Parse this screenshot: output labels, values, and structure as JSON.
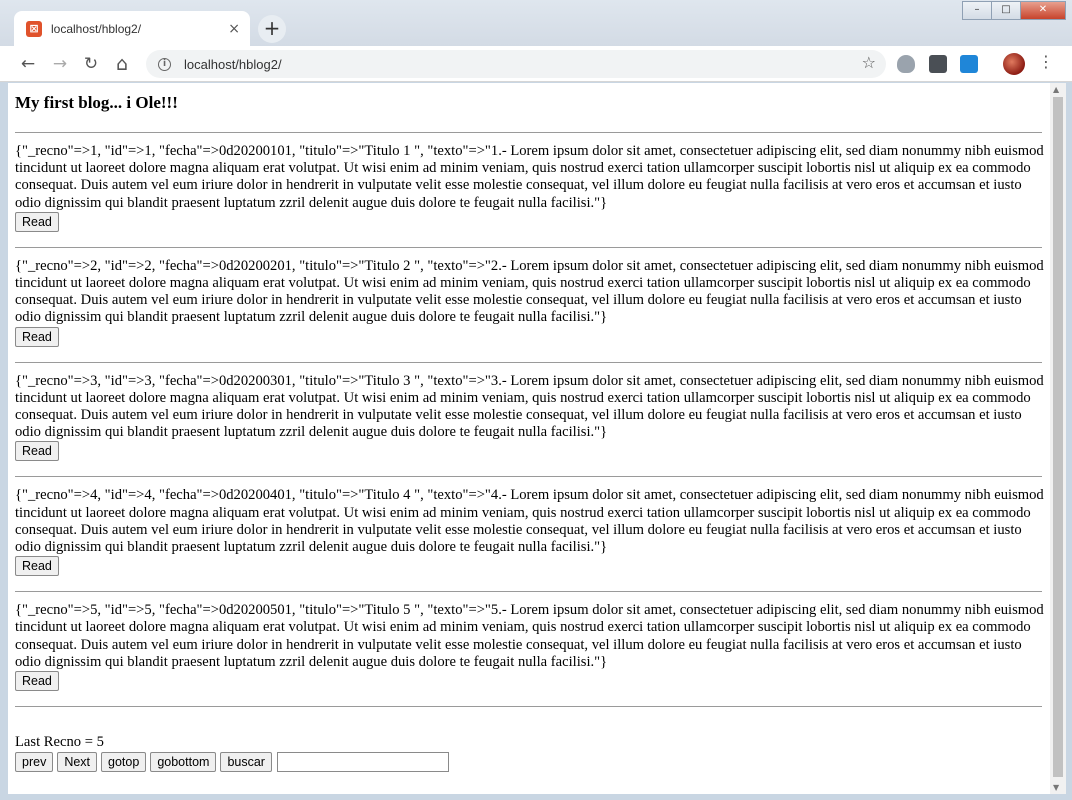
{
  "browser": {
    "tab_title": "localhost/hblog2/",
    "tab_close": "×",
    "new_tab": "+",
    "url": "localhost/hblog2/",
    "window_buttons": {
      "minimize": "–",
      "maximize": "□",
      "close": "✕"
    },
    "icons": {
      "back": "←",
      "forward": "→",
      "reload": "↻",
      "home": "⌂",
      "star": "☆",
      "menu": "⋮",
      "info": "i"
    }
  },
  "page": {
    "title": "My first blog... i Ole!!!",
    "posts": [
      {
        "text": "{\"_recno\"=>1, \"id\"=>1, \"fecha\"=>0d20200101, \"titulo\"=>\"Titulo 1 \", \"texto\"=>\"1.- Lorem ipsum dolor sit amet, consectetuer adipiscing elit, sed diam nonummy nibh euismod tincidunt ut laoreet dolore magna aliquam erat volutpat. Ut wisi enim ad minim veniam, quis nostrud exerci tation ullamcorper suscipit lobortis nisl ut aliquip ex ea commodo consequat. Duis autem vel eum iriure dolor in hendrerit in vulputate velit esse molestie consequat, vel illum dolore eu feugiat nulla facilisis at vero eros et accumsan et iusto odio dignissim qui blandit praesent luptatum zzril delenit augue duis dolore te feugait nulla facilisi.\"}",
        "button": "Read"
      },
      {
        "text": "{\"_recno\"=>2, \"id\"=>2, \"fecha\"=>0d20200201, \"titulo\"=>\"Titulo 2 \", \"texto\"=>\"2.- Lorem ipsum dolor sit amet, consectetuer adipiscing elit, sed diam nonummy nibh euismod tincidunt ut laoreet dolore magna aliquam erat volutpat. Ut wisi enim ad minim veniam, quis nostrud exerci tation ullamcorper suscipit lobortis nisl ut aliquip ex ea commodo consequat. Duis autem vel eum iriure dolor in hendrerit in vulputate velit esse molestie consequat, vel illum dolore eu feugiat nulla facilisis at vero eros et accumsan et iusto odio dignissim qui blandit praesent luptatum zzril delenit augue duis dolore te feugait nulla facilisi.\"}",
        "button": "Read"
      },
      {
        "text": "{\"_recno\"=>3, \"id\"=>3, \"fecha\"=>0d20200301, \"titulo\"=>\"Titulo 3 \", \"texto\"=>\"3.- Lorem ipsum dolor sit amet, consectetuer adipiscing elit, sed diam nonummy nibh euismod tincidunt ut laoreet dolore magna aliquam erat volutpat. Ut wisi enim ad minim veniam, quis nostrud exerci tation ullamcorper suscipit lobortis nisl ut aliquip ex ea commodo consequat. Duis autem vel eum iriure dolor in hendrerit in vulputate velit esse molestie consequat, vel illum dolore eu feugiat nulla facilisis at vero eros et accumsan et iusto odio dignissim qui blandit praesent luptatum zzril delenit augue duis dolore te feugait nulla facilisi.\"}",
        "button": "Read"
      },
      {
        "text": "{\"_recno\"=>4, \"id\"=>4, \"fecha\"=>0d20200401, \"titulo\"=>\"Titulo 4 \", \"texto\"=>\"4.- Lorem ipsum dolor sit amet, consectetuer adipiscing elit, sed diam nonummy nibh euismod tincidunt ut laoreet dolore magna aliquam erat volutpat. Ut wisi enim ad minim veniam, quis nostrud exerci tation ullamcorper suscipit lobortis nisl ut aliquip ex ea commodo consequat. Duis autem vel eum iriure dolor in hendrerit in vulputate velit esse molestie consequat, vel illum dolore eu feugiat nulla facilisis at vero eros et accumsan et iusto odio dignissim qui blandit praesent luptatum zzril delenit augue duis dolore te feugait nulla facilisi.\"}",
        "button": "Read"
      },
      {
        "text": "{\"_recno\"=>5, \"id\"=>5, \"fecha\"=>0d20200501, \"titulo\"=>\"Titulo 5 \", \"texto\"=>\"5.- Lorem ipsum dolor sit amet, consectetuer adipiscing elit, sed diam nonummy nibh euismod tincidunt ut laoreet dolore magna aliquam erat volutpat. Ut wisi enim ad minim veniam, quis nostrud exerci tation ullamcorper suscipit lobortis nisl ut aliquip ex ea commodo consequat. Duis autem vel eum iriure dolor in hendrerit in vulputate velit esse molestie consequat, vel illum dolore eu feugiat nulla facilisis at vero eros et accumsan et iusto odio dignissim qui blandit praesent luptatum zzril delenit augue duis dolore te feugait nulla facilisi.\"}",
        "button": "Read"
      }
    ],
    "last_recno": "Last Recno = 5",
    "controls": {
      "prev": "prev",
      "next": "Next",
      "gotop": "gotop",
      "gobottom": "gobottom",
      "buscar": "buscar",
      "search_value": ""
    }
  }
}
